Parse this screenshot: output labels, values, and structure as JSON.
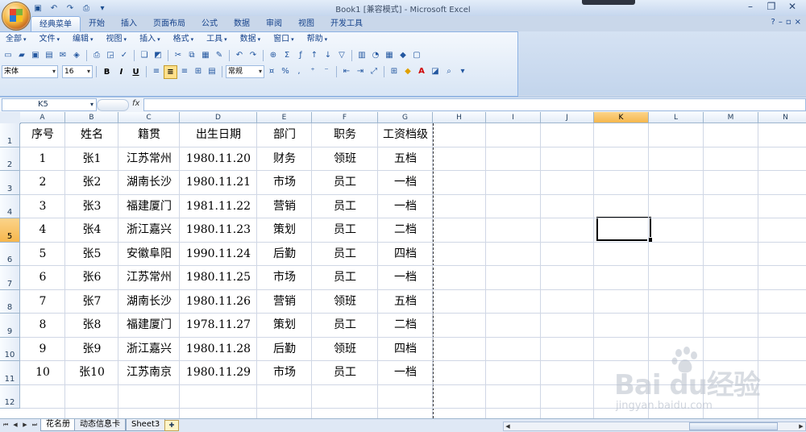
{
  "window": {
    "title_name": "Book1",
    "title_mode": "[兼容模式]",
    "title_app": "Microsoft Excel",
    "separator": "-"
  },
  "ribbon_tabs": [
    "经典菜单",
    "开始",
    "插入",
    "页面布局",
    "公式",
    "数据",
    "审阅",
    "视图",
    "开发工具"
  ],
  "classic_menu": [
    "全部",
    "文件",
    "编辑",
    "视图",
    "插入",
    "格式",
    "工具",
    "数据",
    "窗口",
    "帮助"
  ],
  "font": {
    "name": "宋体",
    "size": "16"
  },
  "number_format": "常规",
  "format_buttons": [
    "B",
    "I",
    "U"
  ],
  "name_box": "K5",
  "fx_label": "fx",
  "columns": [
    "A",
    "B",
    "C",
    "D",
    "E",
    "F",
    "G",
    "H",
    "I",
    "J",
    "K",
    "L",
    "M",
    "N"
  ],
  "selected_column": "K",
  "rows": [
    "1",
    "2",
    "3",
    "4",
    "5",
    "6",
    "7",
    "8",
    "9",
    "10",
    "11",
    "12"
  ],
  "selected_row": "5",
  "table": {
    "headers": [
      "序号",
      "姓名",
      "籍贯",
      "出生日期",
      "部门",
      "职务",
      "工资档级"
    ],
    "rows": [
      [
        "1",
        "张1",
        "江苏常州",
        "1980.11.20",
        "财务",
        "领班",
        "五档"
      ],
      [
        "2",
        "张2",
        "湖南长沙",
        "1980.11.21",
        "市场",
        "员工",
        "一档"
      ],
      [
        "3",
        "张3",
        "福建厦门",
        "1981.11.22",
        "营销",
        "员工",
        "一档"
      ],
      [
        "4",
        "张4",
        "浙江嘉兴",
        "1980.11.23",
        "策划",
        "员工",
        "二档"
      ],
      [
        "5",
        "张5",
        "安徽阜阳",
        "1990.11.24",
        "后勤",
        "员工",
        "四档"
      ],
      [
        "6",
        "张6",
        "江苏常州",
        "1980.11.25",
        "市场",
        "员工",
        "一档"
      ],
      [
        "7",
        "张7",
        "湖南长沙",
        "1980.11.26",
        "营销",
        "领班",
        "五档"
      ],
      [
        "8",
        "张8",
        "福建厦门",
        "1978.11.27",
        "策划",
        "员工",
        "二档"
      ],
      [
        "9",
        "张9",
        "浙江嘉兴",
        "1980.11.28",
        "后勤",
        "领班",
        "四档"
      ],
      [
        "10",
        "张10",
        "江苏南京",
        "1980.11.29",
        "市场",
        "员工",
        "一档"
      ]
    ]
  },
  "sheets": [
    "花名册",
    "动态信息卡",
    "Sheet3"
  ],
  "active_sheet": "花名册",
  "watermark": {
    "brand": "Bai du经验",
    "url": "jingyan.baidu.com"
  },
  "colors": {
    "selected_header": "#f6b74d",
    "ribbon_blue": "#15428b",
    "grid_line": "#d0d7e5"
  }
}
